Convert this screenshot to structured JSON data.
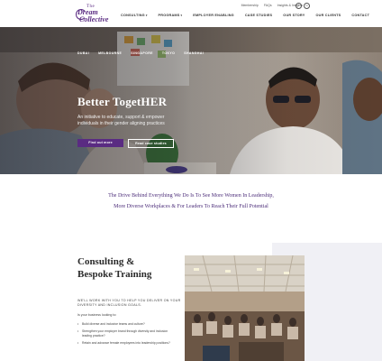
{
  "logo": {
    "line1": "The",
    "line2": "Dream",
    "line3": "Collective"
  },
  "utility_links": [
    "Membership",
    "FAQs",
    "Insights & Insights"
  ],
  "social": [
    "f",
    "in"
  ],
  "nav": [
    {
      "label": "CONSULTING",
      "caret": "▾"
    },
    {
      "label": "PROGRAMS",
      "caret": "▾"
    },
    {
      "label": "EMPLOYER ENABLING",
      "caret": ""
    },
    {
      "label": "CASE STUDIES",
      "caret": ""
    },
    {
      "label": "OUR STORY",
      "caret": ""
    },
    {
      "label": "OUR CLIENTS",
      "caret": ""
    },
    {
      "label": "CONTACT",
      "caret": ""
    }
  ],
  "hero": {
    "cities": [
      "DUBAI",
      "MELBOURNE",
      "SINGAPORE",
      "TOKYO",
      "SHANGHAI"
    ],
    "title": "Better TogetHER",
    "subtitle": "An initiative to educate, support & empower individuals in their gender aligning practices",
    "primary_button": "Find out more",
    "secondary_button": "Read case studies"
  },
  "tagline": {
    "line1": "The Drive Behind Everything We Do Is To See More Women In Leadership,",
    "line2": "More Diverse Workplaces & For Leaders To Reach Their Full Potential"
  },
  "consulting": {
    "title": "Consulting & Bespoke Training",
    "intro": "WE'LL WORK WITH YOU TO HELP YOU DELIVER ON YOUR DIVERSITY AND INCLUSION GOALS.",
    "question": "Is your business looking to:",
    "items": [
      "Build diverse and inclusive teams and culture?",
      "Strengthen your employer brand through diversity and inclusion leading practice?",
      "Retain and advance female employees into leadership positions?"
    ]
  },
  "colors": {
    "brand_purple": "#5a2b82",
    "tagline_purple": "#4d2e7a",
    "section_bg": "#f0f0f5"
  }
}
